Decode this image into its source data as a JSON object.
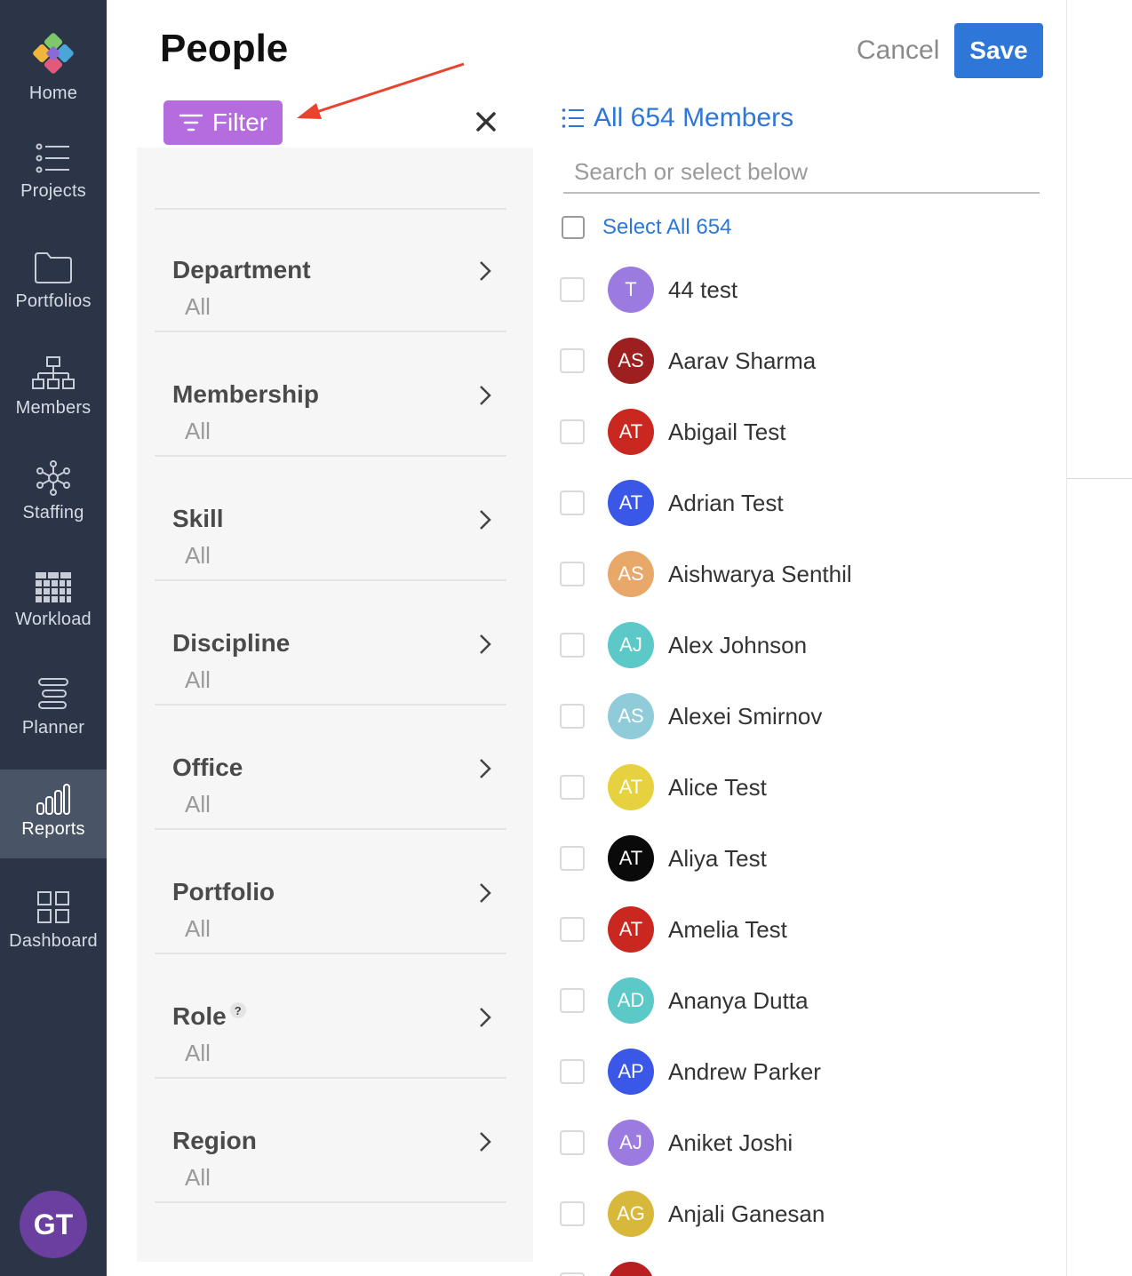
{
  "nav": {
    "items": [
      {
        "label": "Home",
        "icon": "logo-icon"
      },
      {
        "label": "Projects",
        "icon": "list-icon"
      },
      {
        "label": "Portfolios",
        "icon": "folder-icon"
      },
      {
        "label": "Members",
        "icon": "org-chart-icon"
      },
      {
        "label": "Staffing",
        "icon": "network-icon"
      },
      {
        "label": "Workload",
        "icon": "grid-icon"
      },
      {
        "label": "Planner",
        "icon": "planner-icon"
      },
      {
        "label": "Reports",
        "icon": "bar-chart-icon",
        "active": true
      },
      {
        "label": "Dashboard",
        "icon": "dashboard-icon"
      }
    ],
    "user_initials": "GT"
  },
  "header": {
    "title": "People",
    "cancel_label": "Cancel",
    "save_label": "Save",
    "filter_label": "Filter"
  },
  "filters": [
    {
      "name": "Department",
      "value": "All"
    },
    {
      "name": "Membership",
      "value": "All"
    },
    {
      "name": "Skill",
      "value": "All"
    },
    {
      "name": "Discipline",
      "value": "All"
    },
    {
      "name": "Office",
      "value": "All"
    },
    {
      "name": "Portfolio",
      "value": "All"
    },
    {
      "name": "Role",
      "value": "All",
      "help": "?"
    },
    {
      "name": "Region",
      "value": "All"
    }
  ],
  "members": {
    "header": "All 654 Members",
    "search_placeholder": "Search or select below",
    "select_all_label": "Select All 654",
    "list": [
      {
        "initials": "T",
        "name": "44 test",
        "color": "#9b7be0"
      },
      {
        "initials": "AS",
        "name": "Aarav Sharma",
        "color": "#9e1f1f"
      },
      {
        "initials": "AT",
        "name": "Abigail Test",
        "color": "#c9271f"
      },
      {
        "initials": "AT",
        "name": "Adrian Test",
        "color": "#3a57e8"
      },
      {
        "initials": "AS",
        "name": "Aishwarya Senthil",
        "color": "#e8a86a"
      },
      {
        "initials": "AJ",
        "name": "Alex Johnson",
        "color": "#5cc8c8"
      },
      {
        "initials": "AS",
        "name": "Alexei Smirnov",
        "color": "#8fcbd8"
      },
      {
        "initials": "AT",
        "name": "Alice Test",
        "color": "#e6d23e"
      },
      {
        "initials": "AT",
        "name": "Aliya Test",
        "color": "#0a0a0a"
      },
      {
        "initials": "AT",
        "name": "Amelia Test",
        "color": "#c9271f"
      },
      {
        "initials": "AD",
        "name": "Ananya Dutta",
        "color": "#5cc8c8"
      },
      {
        "initials": "AP",
        "name": "Andrew Parker",
        "color": "#3a57e8"
      },
      {
        "initials": "AJ",
        "name": "Aniket Joshi",
        "color": "#9b7be0"
      },
      {
        "initials": "AG",
        "name": "Anjali Ganesan",
        "color": "#d8b83a"
      },
      {
        "initials": "",
        "name": "",
        "color": "#b81f1f"
      }
    ]
  },
  "colors": {
    "sidebar_bg": "#2b3547",
    "accent_blue": "#2e77d8",
    "filter_purple": "#b46cde"
  }
}
